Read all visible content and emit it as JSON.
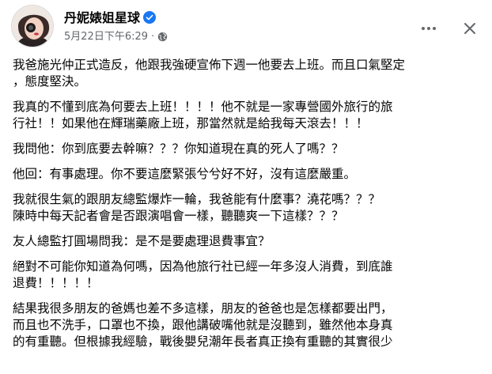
{
  "post": {
    "author": "丹妮婊姐星球",
    "timestamp": "5月22日下午6:29",
    "separator": "·",
    "visibility_icon": "globe-icon",
    "verified_icon": "verified-badge-icon",
    "more_icon": "more-options-icon",
    "close_icon": "close-icon",
    "accent_color": "#1877f2",
    "paragraphs": [
      [
        "我爸施光仲正式造反，他跟我強硬宣佈下週一他要去上班。而且口氣堅定",
        "，態度堅決。"
      ],
      [
        "我真的不懂到底為何要去上班！！！！他不就是一家專營國外旅行的旅",
        "行社！！如果他在輝瑞藥廠上班，那當然就是給我每天滾去！！！"
      ],
      [
        "我問他：你到底要去幹嘛？？？你知道現在真的死人了嗎？？"
      ],
      [
        "他回：有事處理。你不要這麼緊張兮兮好不好，沒有這麼嚴重。"
      ],
      [
        "我就很生氣的跟朋友總監爆炸一輪，我爸能有什麼事？澆花嗎？？？",
        "陳時中每天記者會是否跟演唱會一樣，聽聽爽一下這樣？？？"
      ],
      [
        "友人總監打圓場問我：是不是要處理退費事宜？"
      ],
      [
        "絕對不可能你知道為何嗎，因為他旅行社已經一年多沒人消費，到底誰",
        "退費！！！！！"
      ],
      [
        "結果我很多朋友的爸媽也差不多這樣，朋友的爸爸也是怎樣都要出門，",
        "而且也不洗手，口罩也不換，跟他講破嘴他就是沒聽到，雖然他本身真",
        "的有重聽。但根據我經驗，戰後嬰兒潮年長者真正換有重聽的其實很少"
      ]
    ]
  }
}
